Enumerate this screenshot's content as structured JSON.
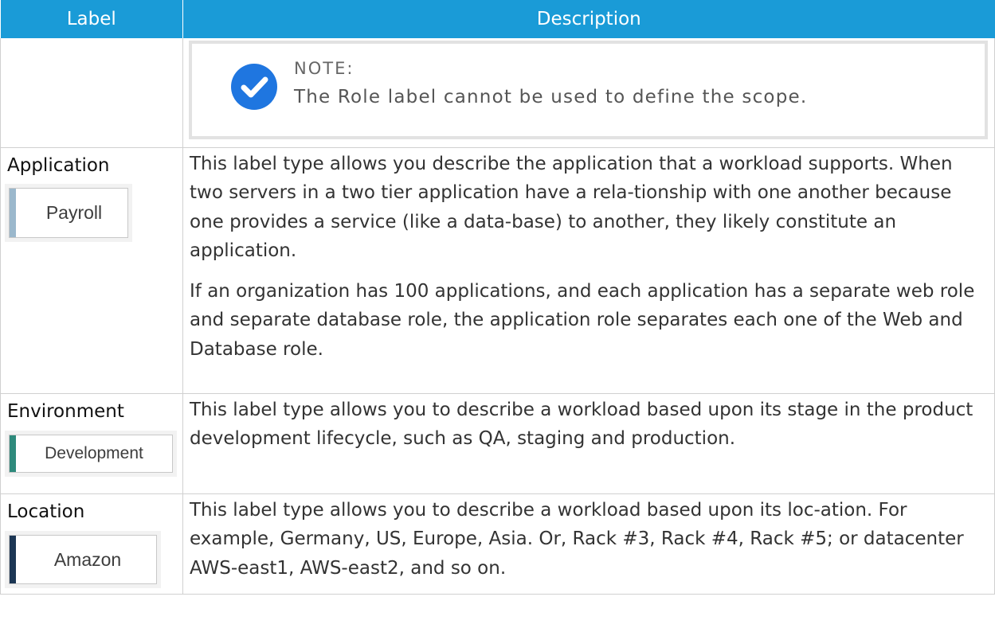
{
  "header": {
    "col_label": "Label",
    "col_description": "Description"
  },
  "note": {
    "title": "NOTE:",
    "text": "The Role label cannot be used to define the scope.",
    "icon": "check-circle-icon",
    "icon_color": "#1f76e0"
  },
  "rows": [
    {
      "name": "Application",
      "tag": {
        "text": "Payroll",
        "accent": "#9bb8cc"
      },
      "paragraphs": [
        "This label type allows you describe the application that a workload supports. When two servers in a two tier application have a rela-tionship with one another because one provides a service (like a data-base) to another, they likely constitute an application.",
        "If an organization has 100 applications, and each application has a separate web role and separate database role, the application role separates each one of the Web and Database role."
      ]
    },
    {
      "name": "Environment",
      "tag": {
        "text": "Development",
        "accent": "#2e8a7c"
      },
      "paragraphs": [
        "This label type allows you to describe a workload based upon its stage in the product development lifecycle, such as QA, staging and production."
      ]
    },
    {
      "name": "Location",
      "tag": {
        "text": "Amazon",
        "accent": "#1c3654"
      },
      "paragraphs": [
        "This label type allows you to describe a workload based upon its loc-ation. For example, Germany, US, Europe, Asia. Or, Rack #3, Rack #4, Rack #5; or datacenter AWS-east1, AWS-east2, and so on."
      ]
    }
  ],
  "colors": {
    "header_bg": "#1a9bd7",
    "header_text": "#ffffff",
    "border": "#d0d0d0"
  }
}
